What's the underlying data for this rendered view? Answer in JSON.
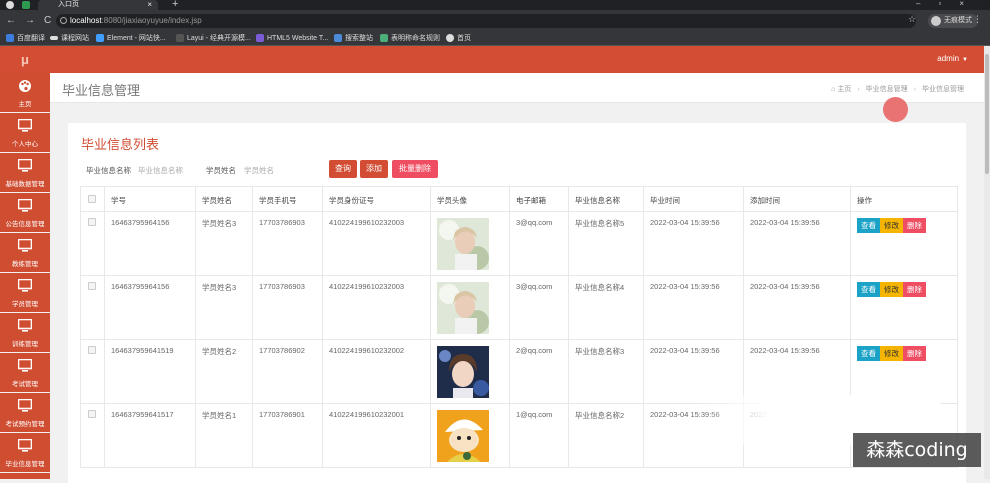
{
  "browser": {
    "tab_title": "入口页",
    "url_host": "localhost",
    "url_path": ":8080/jiaxiaoyuyue/index.jsp",
    "profile_label": "无痕模式",
    "bookmarks": [
      "百度翻译",
      "课程网站",
      "Element - 网站快...",
      "Layui - 经典开源模...",
      "HTML5 Website T...",
      "搜索整站",
      "表明称命名规则",
      "首页"
    ]
  },
  "app": {
    "logo_text": "μ",
    "user": "admin"
  },
  "sidebar": {
    "items": [
      {
        "label": "主页",
        "icon": "palette-icon"
      },
      {
        "label": "个人中心",
        "icon": "monitor-icon"
      },
      {
        "label": "基础数据管理",
        "icon": "monitor-icon"
      },
      {
        "label": "公告信息管理",
        "icon": "monitor-icon"
      },
      {
        "label": "教练管理",
        "icon": "monitor-icon"
      },
      {
        "label": "学员管理",
        "icon": "monitor-icon"
      },
      {
        "label": "训练管理",
        "icon": "monitor-icon"
      },
      {
        "label": "考试管理",
        "icon": "monitor-icon"
      },
      {
        "label": "考试预约管理",
        "icon": "monitor-icon"
      },
      {
        "label": "毕业信息管理",
        "icon": "monitor-icon"
      }
    ]
  },
  "page": {
    "title": "毕业信息管理",
    "breadcrumb": [
      "主页",
      "毕业信息管理",
      "毕业信息管理"
    ],
    "list_title": "毕业信息列表"
  },
  "search": {
    "name_label": "毕业信息名称",
    "name_placeholder": "毕业信息名称",
    "student_label": "学员姓名",
    "student_placeholder": "学员姓名",
    "query_btn": "查询",
    "add_btn": "添加",
    "batch_delete_btn": "批量删除"
  },
  "table": {
    "headers": [
      "学号",
      "学员姓名",
      "学员手机号",
      "学员身份证号",
      "学员头像",
      "电子邮箱",
      "毕业信息名称",
      "毕业时间",
      "添加时间",
      "操作"
    ],
    "rows": [
      {
        "no": "16463795964156",
        "name": "学员姓名3",
        "phone": "17703786903",
        "id": "410224199610232003",
        "email": "3@qq.com",
        "grad": "毕业信息名称5",
        "time": "2022-03-04 15:39:56",
        "added": "2022-03-04 15:39:56"
      },
      {
        "no": "16463795964156",
        "name": "学员姓名3",
        "phone": "17703786903",
        "id": "410224199610232003",
        "email": "3@qq.com",
        "grad": "毕业信息名称4",
        "time": "2022-03-04 15:39:56",
        "added": "2022-03-04 15:39:56"
      },
      {
        "no": "164637959641519",
        "name": "学员姓名2",
        "phone": "17703786902",
        "id": "410224199610232002",
        "email": "2@qq.com",
        "grad": "毕业信息名称3",
        "time": "2022-03-04 15:39:56",
        "added": "2022-03-04 15:39:56"
      },
      {
        "no": "164637959641517",
        "name": "学员姓名1",
        "phone": "17703786901",
        "id": "410224199610232001",
        "email": "1@qq.com",
        "grad": "毕业信息名称2",
        "time": "2022-03-04 15:39:56",
        "added": "2022-03-04 15:39:56"
      }
    ],
    "actions": {
      "view": "查看",
      "edit": "修改",
      "delete": "删除"
    }
  },
  "watermark": "森森coding",
  "colors": {
    "brand": "#d24d33",
    "view": "#1aa3c7",
    "edit": "#f4b400",
    "delete": "#ef4d62"
  }
}
